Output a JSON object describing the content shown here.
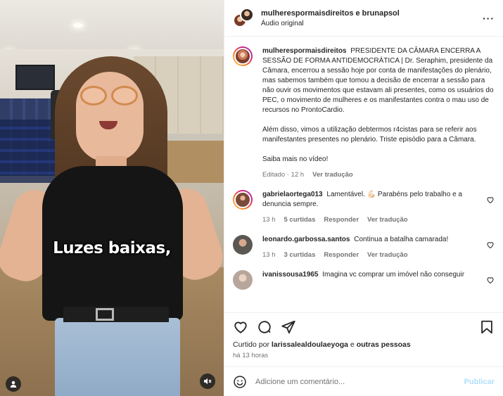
{
  "header": {
    "users": "mulherespormaisdireitos e brunapsol",
    "audio": "Áudio original",
    "more_icon": "more-horizontal-icon"
  },
  "video": {
    "caption": "Luzes baixas,",
    "user_icon": "user-icon",
    "mute_icon": "muted-speaker-icon"
  },
  "post": {
    "author": "mulherespormaisdireitos",
    "caption_p1": "PRESIDENTE DA CÂMARA ENCERRA A SESSÃO DE FORMA ANTIDEMOCRÁTICA | Dr. Seraphim, presidente da Câmara, encerrou a sessão hoje por conta de manifestações do plenário, mas sabemos também que tomou a decisão de encerrar a sessão para não ouvir os movimentos que estavam ali presentes, como os usuários do PEC, o movimento de mulheres e os manifestantes contra o mau uso de recursos no ProntoCardio.",
    "caption_p2": "Além disso, vimos a utilização debtermos r4cistas para se referir aos manifestantes presentes no plenário. Triste episódio para a Câmara.",
    "caption_p3": "Saiba mais no vídeo!",
    "edited": "Editado · 12 h",
    "translate": "Ver tradução"
  },
  "comments": [
    {
      "user": "gabrielaortega013",
      "text": "Lamentável. 💪🏻 Parabéns pelo trabalho e a denuncia sempre.",
      "time": "13 h",
      "likes": "5 curtidas",
      "reply": "Responder",
      "translate": "Ver tradução",
      "avatar": "#7a4a3a"
    },
    {
      "user": "leonardo.garbossa.santos",
      "text": "Continua a batalha camarada!",
      "time": "13 h",
      "likes": "3 curtidas",
      "reply": "Responder",
      "translate": "Ver tradução",
      "avatar": "#6d6a66"
    },
    {
      "user": "ivanissousa1965",
      "text": "Imagina vc comprar um imóvel não conseguir",
      "time": "",
      "likes": "",
      "reply": "",
      "translate": "",
      "avatar": "#c7b9b0"
    }
  ],
  "actions": {
    "like_icon": "heart-icon",
    "comment_icon": "comment-icon",
    "share_icon": "send-icon",
    "save_icon": "bookmark-icon"
  },
  "likes": {
    "prefix": "Curtido por ",
    "user": "larissalealdoulaeyoga",
    "suffix": " e ",
    "others": "outras pessoas"
  },
  "time_ago": "há 13 horas",
  "add_comment": {
    "placeholder": "Adicione um comentário...",
    "publish": "Publicar",
    "emoji_icon": "emoji-icon"
  },
  "colors": {
    "link_blue": "#0095f6",
    "publish_disabled": "#b2dffc",
    "text": "#262626",
    "muted": "#737373"
  }
}
